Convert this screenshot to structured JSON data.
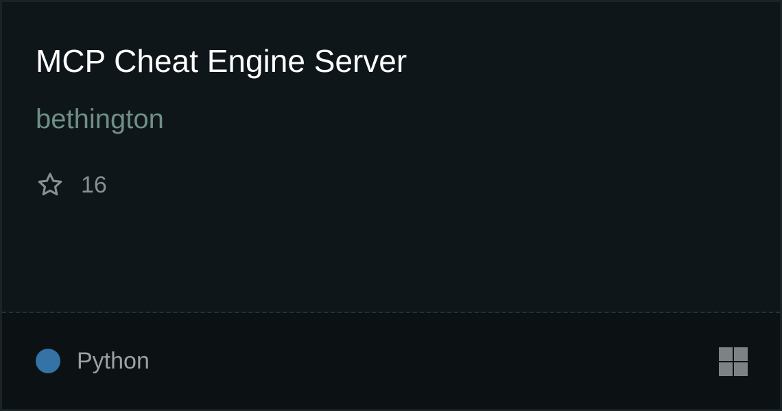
{
  "repo": {
    "title": "MCP Cheat Engine Server",
    "owner": "bethington",
    "stars": "16",
    "language": "Python",
    "language_color": "#3572a5"
  },
  "icons": {
    "star": "star-outline-icon",
    "platform": "windows-icon"
  }
}
